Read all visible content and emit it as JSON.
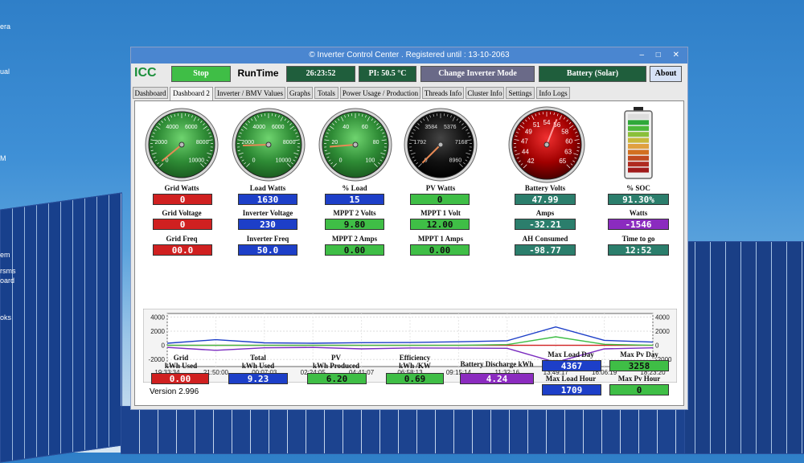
{
  "window": {
    "title": "© Inverter Control Center . Registered until : 13-10-2063"
  },
  "desktop": {
    "left_labels": [
      "era",
      "ual",
      "M",
      "em",
      "rsms",
      "oard",
      "oks"
    ]
  },
  "toolbar": {
    "stop_label": "Stop",
    "runtime_label": "RunTime",
    "runtime_value": "26:23:52",
    "pi_value": "PI: 50.5 °C",
    "change_mode_label": "Change Inverter Mode",
    "battery_mode": "Battery (Solar)",
    "about_label": "About",
    "logo_text": "ICC"
  },
  "tabs": [
    "Dashboard",
    "Dashboard 2",
    "Inverter / BMV Values",
    "Graphs",
    "Totals",
    "Power Usage / Production",
    "Threads Info",
    "Cluster Info",
    "Settings",
    "Info Logs"
  ],
  "gauges": [
    {
      "name": "grid-watts-gauge",
      "labels": [
        "2000",
        "4000",
        "6000",
        "8000",
        "10000",
        "0"
      ],
      "value_frac": 0.02,
      "face": "green"
    },
    {
      "name": "load-watts-gauge",
      "labels": [
        "2000",
        "4000",
        "6000",
        "8000",
        "10000",
        "0"
      ],
      "value_frac": 0.16,
      "face": "green"
    },
    {
      "name": "load-pct-gauge",
      "labels": [
        "20",
        "40",
        "60",
        "80",
        "100",
        "0"
      ],
      "value_frac": 0.15,
      "face": "green"
    },
    {
      "name": "pv-watts-gauge",
      "labels": [
        "1792",
        "3584",
        "5376",
        "7168",
        "8960",
        "0"
      ],
      "value_frac": 0.0,
      "face": "black"
    },
    {
      "name": "battery-volts-gauge",
      "labels": [
        "44",
        "47",
        "49",
        "51",
        "54",
        "56",
        "58",
        "60",
        "63",
        "65",
        "42"
      ],
      "value_frac": 0.58,
      "face": "red"
    }
  ],
  "fields": {
    "grid_watts": {
      "label": "Grid Watts",
      "value": "0"
    },
    "grid_voltage": {
      "label": "Grid Voltage",
      "value": "0"
    },
    "grid_freq": {
      "label": "Grid Freq",
      "value": "00.0"
    },
    "load_watts": {
      "label": "Load Watts",
      "value": "1630"
    },
    "inverter_voltage": {
      "label": "Inverter Voltage",
      "value": "230"
    },
    "inverter_freq": {
      "label": "Inverter Freq",
      "value": "50.0"
    },
    "load_pct": {
      "label": "% Load",
      "value": "15"
    },
    "mppt2_volts": {
      "label": "MPPT 2 Volts",
      "value": "9.80"
    },
    "mppt2_amps": {
      "label": "MPPT 2 Amps",
      "value": "0.00"
    },
    "pv_watts": {
      "label": "PV Watts",
      "value": "0"
    },
    "mppt1_volt": {
      "label": "MPPT 1 Volt",
      "value": "12.00"
    },
    "mppt1_amps": {
      "label": "MPPT 1 Amps",
      "value": "0.00"
    },
    "battery_volts": {
      "label": "Battery Volts",
      "value": "47.99"
    },
    "amps": {
      "label": "Amps",
      "value": "-32.21"
    },
    "ah_consumed": {
      "label": "AH Consumed",
      "value": "-98.77"
    },
    "soc": {
      "label": "% SOC",
      "value": "91.30%",
      "level": 0.913
    },
    "watts": {
      "label": "Watts",
      "value": "-1546"
    },
    "time_to_go": {
      "label": "Time to go",
      "value": "12:52"
    }
  },
  "totals": {
    "grid_kwh": {
      "label1": "Grid",
      "label2": "kWh Used",
      "value": "0.00"
    },
    "total_kwh": {
      "label1": "Total",
      "label2": "kWh Used",
      "value": "9.23"
    },
    "pv_kwh": {
      "label1": "PV",
      "label2": "kWh Produced",
      "value": "6.20"
    },
    "efficiency": {
      "label1": "Efficiency",
      "label2": "kWh /KW",
      "value": "0.69"
    },
    "battery_discharge": {
      "label1": "Battery Discharge kWh",
      "value": "4.24"
    },
    "max_load_day": {
      "label": "Max Load Day",
      "value": "4367"
    },
    "max_load_hour": {
      "label": "Max Load Hour",
      "value": "1709"
    },
    "max_pv_day": {
      "label": "Max Pv Day",
      "value": "3258"
    },
    "max_pv_hour": {
      "label": "Max Pv Hour",
      "value": "0"
    }
  },
  "version": "Version 2.996",
  "chart_data": {
    "type": "line",
    "x": [
      "19:33:34",
      "21:50:00",
      "00:07:03",
      "02:24:05",
      "04:41:07",
      "06:58:13",
      "09:15:14",
      "11:32:16",
      "13:49:17",
      "16:06:19",
      "18:23:20"
    ],
    "y_ticks": [
      "4000",
      "2000",
      "0",
      "-2000"
    ],
    "ylim": [
      -3000,
      4500
    ],
    "series": [
      {
        "color": "#1d3fc8",
        "values": [
          300,
          800,
          350,
          300,
          380,
          400,
          500,
          650,
          2600,
          700,
          450
        ]
      },
      {
        "color": "#d02020",
        "values": [
          0,
          0,
          0,
          0,
          0,
          0,
          0,
          0,
          0,
          0,
          0
        ]
      },
      {
        "color": "#7a2bbf",
        "values": [
          -300,
          -700,
          -350,
          -300,
          -500,
          -380,
          -400,
          -420,
          -2400,
          -500,
          -350
        ]
      },
      {
        "color": "#3fbe46",
        "values": [
          0,
          0,
          0,
          0,
          0,
          0,
          0,
          100,
          1200,
          150,
          0
        ]
      }
    ]
  }
}
